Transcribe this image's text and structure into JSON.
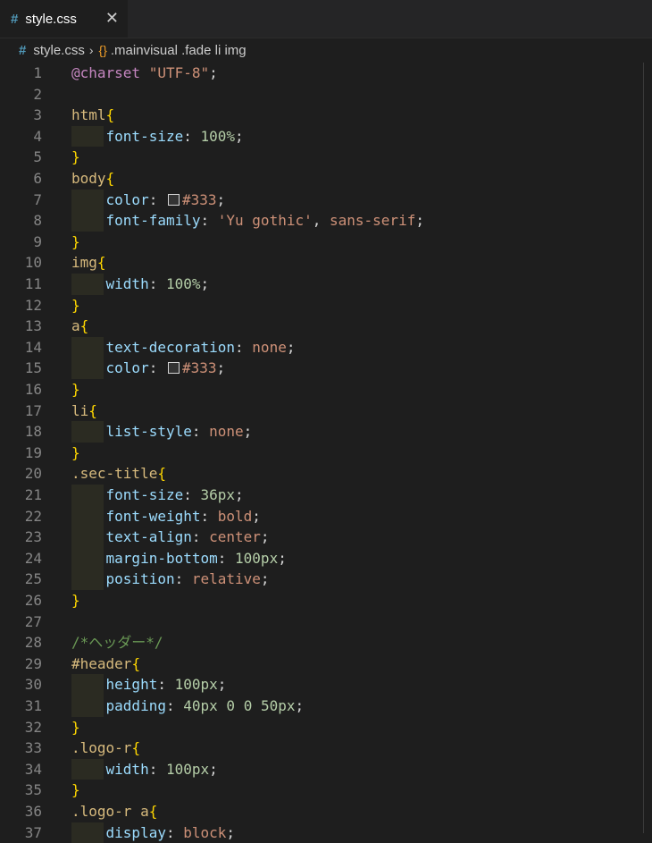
{
  "tab": {
    "icon": "#",
    "label": "style.css",
    "close": "✕"
  },
  "breadcrumb": {
    "file_icon": "#",
    "file": "style.css",
    "separator": "›",
    "symbol_icon": "{}",
    "symbol": ".mainvisual .fade li img"
  },
  "lines": [
    {
      "n": "1",
      "indent": false,
      "tokens": [
        [
          "t-at",
          "@charset"
        ],
        [
          "t-punc",
          " "
        ],
        [
          "t-str",
          "\"UTF-8\""
        ],
        [
          "t-punc",
          ";"
        ]
      ]
    },
    {
      "n": "2",
      "indent": false,
      "tokens": []
    },
    {
      "n": "3",
      "indent": false,
      "tokens": [
        [
          "t-sel",
          "html"
        ],
        [
          "t-brace",
          "{"
        ]
      ]
    },
    {
      "n": "4",
      "indent": true,
      "tokens": [
        [
          "t-punc",
          "    "
        ],
        [
          "t-prop",
          "font-size"
        ],
        [
          "t-punc",
          ": "
        ],
        [
          "t-num",
          "100%"
        ],
        [
          "t-punc",
          ";"
        ]
      ]
    },
    {
      "n": "5",
      "indent": false,
      "tokens": [
        [
          "t-brace",
          "}"
        ]
      ]
    },
    {
      "n": "6",
      "indent": false,
      "tokens": [
        [
          "t-sel",
          "body"
        ],
        [
          "t-brace",
          "{"
        ]
      ]
    },
    {
      "n": "7",
      "indent": true,
      "tokens": [
        [
          "t-punc",
          "    "
        ],
        [
          "t-prop",
          "color"
        ],
        [
          "t-punc",
          ": "
        ],
        [
          "swatch",
          ""
        ],
        [
          "t-val",
          "#333"
        ],
        [
          "t-punc",
          ";"
        ]
      ]
    },
    {
      "n": "8",
      "indent": true,
      "tokens": [
        [
          "t-punc",
          "    "
        ],
        [
          "t-prop",
          "font-family"
        ],
        [
          "t-punc",
          ": "
        ],
        [
          "t-str",
          "'Yu gothic'"
        ],
        [
          "t-punc",
          ", "
        ],
        [
          "t-val",
          "sans-serif"
        ],
        [
          "t-punc",
          ";"
        ]
      ]
    },
    {
      "n": "9",
      "indent": false,
      "tokens": [
        [
          "t-brace",
          "}"
        ]
      ]
    },
    {
      "n": "10",
      "indent": false,
      "tokens": [
        [
          "t-sel",
          "img"
        ],
        [
          "t-brace",
          "{"
        ]
      ]
    },
    {
      "n": "11",
      "indent": true,
      "tokens": [
        [
          "t-punc",
          "    "
        ],
        [
          "t-prop",
          "width"
        ],
        [
          "t-punc",
          ": "
        ],
        [
          "t-num",
          "100%"
        ],
        [
          "t-punc",
          ";"
        ]
      ]
    },
    {
      "n": "12",
      "indent": false,
      "tokens": [
        [
          "t-brace",
          "}"
        ]
      ]
    },
    {
      "n": "13",
      "indent": false,
      "tokens": [
        [
          "t-sel",
          "a"
        ],
        [
          "t-brace",
          "{"
        ]
      ]
    },
    {
      "n": "14",
      "indent": true,
      "tokens": [
        [
          "t-punc",
          "    "
        ],
        [
          "t-prop",
          "text-decoration"
        ],
        [
          "t-punc",
          ": "
        ],
        [
          "t-val",
          "none"
        ],
        [
          "t-punc",
          ";"
        ]
      ]
    },
    {
      "n": "15",
      "indent": true,
      "tokens": [
        [
          "t-punc",
          "    "
        ],
        [
          "t-prop",
          "color"
        ],
        [
          "t-punc",
          ": "
        ],
        [
          "swatch",
          ""
        ],
        [
          "t-val",
          "#333"
        ],
        [
          "t-punc",
          ";"
        ]
      ]
    },
    {
      "n": "16",
      "indent": false,
      "tokens": [
        [
          "t-brace",
          "}"
        ]
      ]
    },
    {
      "n": "17",
      "indent": false,
      "tokens": [
        [
          "t-sel",
          "li"
        ],
        [
          "t-brace",
          "{"
        ]
      ]
    },
    {
      "n": "18",
      "indent": true,
      "tokens": [
        [
          "t-punc",
          "    "
        ],
        [
          "t-prop",
          "list-style"
        ],
        [
          "t-punc",
          ": "
        ],
        [
          "t-val",
          "none"
        ],
        [
          "t-punc",
          ";"
        ]
      ]
    },
    {
      "n": "19",
      "indent": false,
      "tokens": [
        [
          "t-brace",
          "}"
        ]
      ]
    },
    {
      "n": "20",
      "indent": false,
      "tokens": [
        [
          "t-sel",
          ".sec-title"
        ],
        [
          "t-brace",
          "{"
        ]
      ]
    },
    {
      "n": "21",
      "indent": true,
      "tokens": [
        [
          "t-punc",
          "    "
        ],
        [
          "t-prop",
          "font-size"
        ],
        [
          "t-punc",
          ": "
        ],
        [
          "t-num",
          "36px"
        ],
        [
          "t-punc",
          ";"
        ]
      ]
    },
    {
      "n": "22",
      "indent": true,
      "tokens": [
        [
          "t-punc",
          "    "
        ],
        [
          "t-prop",
          "font-weight"
        ],
        [
          "t-punc",
          ": "
        ],
        [
          "t-val",
          "bold"
        ],
        [
          "t-punc",
          ";"
        ]
      ]
    },
    {
      "n": "23",
      "indent": true,
      "tokens": [
        [
          "t-punc",
          "    "
        ],
        [
          "t-prop",
          "text-align"
        ],
        [
          "t-punc",
          ": "
        ],
        [
          "t-val",
          "center"
        ],
        [
          "t-punc",
          ";"
        ]
      ]
    },
    {
      "n": "24",
      "indent": true,
      "tokens": [
        [
          "t-punc",
          "    "
        ],
        [
          "t-prop",
          "margin-bottom"
        ],
        [
          "t-punc",
          ": "
        ],
        [
          "t-num",
          "100px"
        ],
        [
          "t-punc",
          ";"
        ]
      ]
    },
    {
      "n": "25",
      "indent": true,
      "tokens": [
        [
          "t-punc",
          "    "
        ],
        [
          "t-prop",
          "position"
        ],
        [
          "t-punc",
          ": "
        ],
        [
          "t-val",
          "relative"
        ],
        [
          "t-punc",
          ";"
        ]
      ]
    },
    {
      "n": "26",
      "indent": false,
      "tokens": [
        [
          "t-brace",
          "}"
        ]
      ]
    },
    {
      "n": "27",
      "indent": false,
      "tokens": []
    },
    {
      "n": "28",
      "indent": false,
      "tokens": [
        [
          "t-com",
          "/*ヘッダー*/"
        ]
      ]
    },
    {
      "n": "29",
      "indent": false,
      "tokens": [
        [
          "t-sel",
          "#header"
        ],
        [
          "t-brace",
          "{"
        ]
      ]
    },
    {
      "n": "30",
      "indent": true,
      "tokens": [
        [
          "t-punc",
          "    "
        ],
        [
          "t-prop",
          "height"
        ],
        [
          "t-punc",
          ": "
        ],
        [
          "t-num",
          "100px"
        ],
        [
          "t-punc",
          ";"
        ]
      ]
    },
    {
      "n": "31",
      "indent": true,
      "tokens": [
        [
          "t-punc",
          "    "
        ],
        [
          "t-prop",
          "padding"
        ],
        [
          "t-punc",
          ": "
        ],
        [
          "t-num",
          "40px"
        ],
        [
          "t-punc",
          " "
        ],
        [
          "t-num",
          "0"
        ],
        [
          "t-punc",
          " "
        ],
        [
          "t-num",
          "0"
        ],
        [
          "t-punc",
          " "
        ],
        [
          "t-num",
          "50px"
        ],
        [
          "t-punc",
          ";"
        ]
      ]
    },
    {
      "n": "32",
      "indent": false,
      "tokens": [
        [
          "t-brace",
          "}"
        ]
      ]
    },
    {
      "n": "33",
      "indent": false,
      "tokens": [
        [
          "t-sel",
          ".logo-r"
        ],
        [
          "t-brace",
          "{"
        ]
      ]
    },
    {
      "n": "34",
      "indent": true,
      "tokens": [
        [
          "t-punc",
          "    "
        ],
        [
          "t-prop",
          "width"
        ],
        [
          "t-punc",
          ": "
        ],
        [
          "t-num",
          "100px"
        ],
        [
          "t-punc",
          ";"
        ]
      ]
    },
    {
      "n": "35",
      "indent": false,
      "tokens": [
        [
          "t-brace",
          "}"
        ]
      ]
    },
    {
      "n": "36",
      "indent": false,
      "tokens": [
        [
          "t-sel",
          ".logo-r a"
        ],
        [
          "t-brace",
          "{"
        ]
      ]
    },
    {
      "n": "37",
      "indent": true,
      "tokens": [
        [
          "t-punc",
          "    "
        ],
        [
          "t-prop",
          "display"
        ],
        [
          "t-punc",
          ": "
        ],
        [
          "t-val",
          "block"
        ],
        [
          "t-punc",
          ";"
        ]
      ]
    }
  ]
}
